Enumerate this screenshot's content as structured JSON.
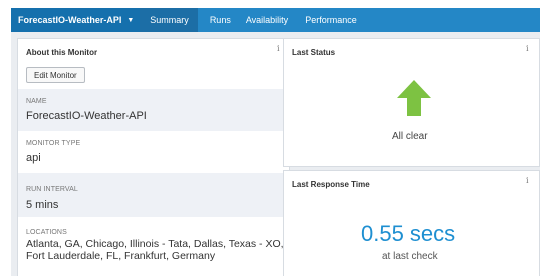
{
  "nav": {
    "monitor_name": "ForecastIO-Weather-API",
    "tabs": [
      {
        "label": "Summary",
        "active": true
      },
      {
        "label": "Runs",
        "active": false
      },
      {
        "label": "Availability",
        "active": false
      },
      {
        "label": "Performance",
        "active": false
      }
    ]
  },
  "about": {
    "title": "About this Monitor",
    "edit_label": "Edit Monitor",
    "fields": [
      {
        "label": "NAME",
        "value": "ForecastIO-Weather-API"
      },
      {
        "label": "MONITOR TYPE",
        "value": "api"
      },
      {
        "label": "RUN INTERVAL",
        "value": "5 mins"
      },
      {
        "label": "LOCATIONS",
        "value": "Atlanta, GA, Chicago, Illinois - Tata, Dallas, Texas - XO, Fort Lauderdale, FL, Frankfurt, Germany"
      }
    ]
  },
  "last_status": {
    "title": "Last Status",
    "status_text": "All clear",
    "arrow_color": "#7dc242"
  },
  "last_response": {
    "title": "Last Response Time",
    "value": "0.55 secs",
    "sub": "at last check"
  },
  "info_glyph": "i",
  "colors": {
    "nav": "#2487c6",
    "nav_active": "#1c6ea6",
    "accent": "#1e8fd1"
  }
}
